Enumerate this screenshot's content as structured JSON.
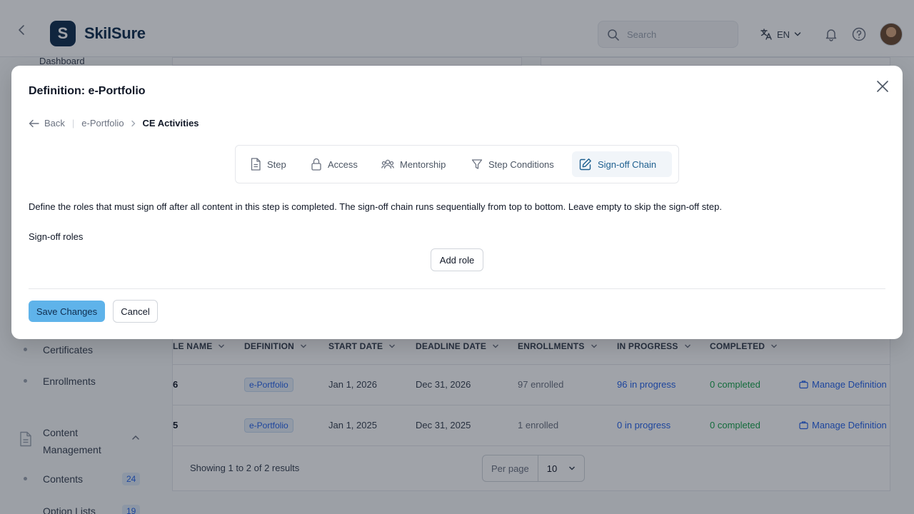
{
  "app": {
    "brand": "SkilSure",
    "logo_letter": "S",
    "search_placeholder": "Search",
    "language": "EN"
  },
  "sidebar": {
    "dashboard_label": "Dashboard",
    "items": [
      {
        "label": "Certificates"
      },
      {
        "label": "Enrollments"
      }
    ],
    "group": {
      "label": "Content Management"
    },
    "sub_items": [
      {
        "label": "Contents",
        "count": "24"
      },
      {
        "label": "Option Lists",
        "count": "19"
      }
    ]
  },
  "table": {
    "columns": [
      "LE NAME",
      "DEFINITION",
      "START DATE",
      "DEADLINE DATE",
      "ENROLLMENTS",
      "IN PROGRESS",
      "COMPLETED"
    ],
    "rows": [
      {
        "name": "6",
        "definition": "e-Portfolio",
        "start": "Jan 1, 2026",
        "deadline": "Dec 31, 2026",
        "enrollments": "97 enrolled",
        "in_progress": "96 in progress",
        "completed": "0 completed",
        "action": "Manage Definition"
      },
      {
        "name": "5",
        "definition": "e-Portfolio",
        "start": "Jan 1, 2025",
        "deadline": "Dec 31, 2025",
        "enrollments": "1 enrolled",
        "in_progress": "0 in progress",
        "completed": "0 completed",
        "action": "Manage Definition"
      }
    ],
    "pagination_text": "Showing 1 to 2 of 2 results",
    "per_page_label": "Per page",
    "per_page_value": "10"
  },
  "modal": {
    "title": "Definition: e-Portfolio",
    "breadcrumb": {
      "back": "Back",
      "parent": "e-Portfolio",
      "current": "CE Activities"
    },
    "tabs": [
      {
        "label": "Step",
        "icon": "document-icon"
      },
      {
        "label": "Access",
        "icon": "lock-icon"
      },
      {
        "label": "Mentorship",
        "icon": "users-icon"
      },
      {
        "label": "Step Conditions",
        "icon": "filter-icon"
      },
      {
        "label": "Sign-off Chain",
        "icon": "edit-icon",
        "active": true
      }
    ],
    "description": "Define the roles that must sign off after all content in this step is completed. The sign-off chain runs sequentially from top to bottom. Leave empty to skip the sign-off step.",
    "section_label": "Sign-off roles",
    "add_role": "Add role",
    "save": "Save Changes",
    "cancel": "Cancel"
  },
  "colors": {
    "brand": "#0f2d4e",
    "primary_button": "#5fb3ea",
    "link_blue": "#2563eb",
    "success_green": "#16a34a"
  }
}
